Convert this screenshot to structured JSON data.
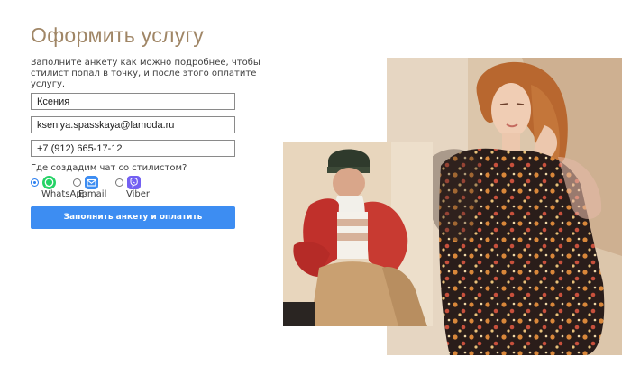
{
  "page": {
    "title": "Оформить услугу",
    "description": "Заполните анкету как можно подробнее, чтобы стилист попал в точку, и после этого оплатите услугу."
  },
  "form": {
    "name_value": "Ксения",
    "email_value": "kseniya.spasskaya@lamoda.ru",
    "phone_value": "+7 (912) 665-17-12",
    "chat_question": "Где создадим чат со стилистом?",
    "chat_options": [
      {
        "label": "WhatsApp",
        "icon": "whatsapp-icon",
        "selected": true,
        "color": "#25d366"
      },
      {
        "label": "E-mail",
        "icon": "mail-icon",
        "selected": false,
        "color": "#3d8df2"
      },
      {
        "label": "Viber",
        "icon": "viber-icon",
        "selected": false,
        "color": "#7360f2"
      }
    ],
    "submit_label": "Заполнить анкету и оплатить"
  },
  "colors": {
    "title": "#a08666",
    "accent": "#3d8df2"
  }
}
